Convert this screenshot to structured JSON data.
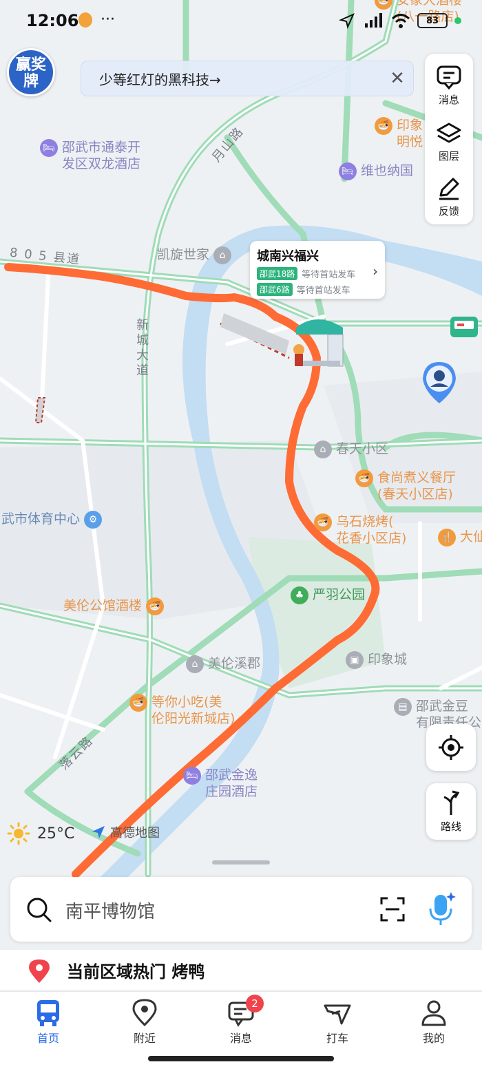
{
  "status_bar": {
    "time": "12:06",
    "dots": "···",
    "battery": "83"
  },
  "promo": {
    "logo_text": "赢奖牌",
    "banner_text": "少等红灯的黑科技→",
    "close": "✕"
  },
  "tools": [
    {
      "label": "消息",
      "icon": "message-icon"
    },
    {
      "label": "图层",
      "icon": "layers-icon"
    },
    {
      "label": "反馈",
      "icon": "feedback-pen-icon"
    }
  ],
  "map": {
    "road_labels": {
      "yueshan": "月山路",
      "county805": "8 0 5 县道",
      "xincheng": "新城大道",
      "luoyun": "落云路"
    },
    "pois": [
      {
        "id": "tongtai",
        "text": "邵武市通泰开\n发区双龙酒店",
        "kind": "hotel"
      },
      {
        "id": "weiyena",
        "text": "维也纳国",
        "kind": "hotel"
      },
      {
        "id": "yinxiang_mingyue",
        "text": "印象\n明悦",
        "kind": "food"
      },
      {
        "id": "anxiang",
        "text": "安象大酒楼\n(八一路店)",
        "kind": "food"
      },
      {
        "id": "kaixuan",
        "text": "凯旋世家",
        "kind": "grey"
      },
      {
        "id": "chuntian",
        "text": "春天小区",
        "kind": "grey"
      },
      {
        "id": "shishang",
        "text": "食尚煮义餐厅\n(春天小区店)",
        "kind": "food"
      },
      {
        "id": "tiyu",
        "text": "武市体育中心",
        "kind": "blue"
      },
      {
        "id": "wushi",
        "text": "乌石烧烤(\n花香小区店)",
        "kind": "food"
      },
      {
        "id": "dafu",
        "text": "大仙",
        "kind": "food"
      },
      {
        "id": "yanyu",
        "text": "严羽公园",
        "kind": "park"
      },
      {
        "id": "meilun_hotel",
        "text": "美伦公馆酒楼",
        "kind": "food"
      },
      {
        "id": "meilun_xijun",
        "text": "美伦溪郡",
        "kind": "grey"
      },
      {
        "id": "yinxiangcheng",
        "text": "印象城",
        "kind": "grey"
      },
      {
        "id": "dengni",
        "text": "等你小吃(美\n伦阳光新城店)",
        "kind": "food"
      },
      {
        "id": "jindou",
        "text": "邵武金豆\n有限责任公",
        "kind": "grey"
      },
      {
        "id": "jinyi",
        "text": "邵武金逸\n庄园酒店",
        "kind": "hotel"
      }
    ]
  },
  "station_card": {
    "name": "城南兴福兴",
    "routes": [
      {
        "route": "邵武18路",
        "status": "等待首站发车"
      },
      {
        "route": "邵武6路",
        "status": "等待首站发车"
      }
    ]
  },
  "weather": {
    "temp": "25°C",
    "icon": "sun-icon"
  },
  "brand": {
    "name": "高德地图"
  },
  "route_button": {
    "label": "路线"
  },
  "search": {
    "placeholder": "南平博物馆"
  },
  "hot": {
    "text": "当前区域热门 烤鸭"
  },
  "tabs": [
    {
      "label": "首页",
      "icon": "bus-home-icon",
      "active": true
    },
    {
      "label": "附近",
      "icon": "location-pin-icon",
      "active": false
    },
    {
      "label": "消息",
      "icon": "chat-icon",
      "active": false,
      "badge": "2"
    },
    {
      "label": "打车",
      "icon": "taxi-icon",
      "active": false
    },
    {
      "label": "我的",
      "icon": "user-icon",
      "active": false
    }
  ],
  "colors": {
    "accent": "#2b6be6",
    "route": "#ff6b35",
    "road": "#9fdcb7",
    "river": "#c3ddf3",
    "badge": "#f0434b"
  }
}
